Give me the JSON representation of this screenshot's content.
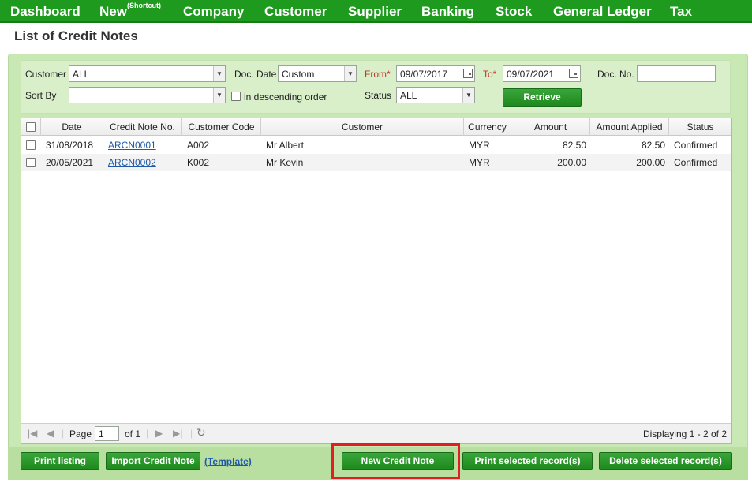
{
  "nav": {
    "items": [
      "Dashboard",
      "New",
      "Company",
      "Customer",
      "Supplier",
      "Banking",
      "Stock",
      "General Ledger",
      "Tax"
    ],
    "new_sup": "(Shortcut)"
  },
  "page": {
    "title": "List of Credit Notes"
  },
  "filters": {
    "customer_label": "Customer",
    "customer_value": "ALL",
    "doc_date_label": "Doc. Date",
    "doc_date_value": "Custom",
    "from_label": "From*",
    "from_value": "09/07/2017",
    "to_label": "To*",
    "to_value": "09/07/2021",
    "doc_no_label": "Doc. No.",
    "doc_no_value": "",
    "sort_by_label": "Sort By",
    "sort_by_value": "",
    "desc_label": "in descending order",
    "status_label": "Status",
    "status_value": "ALL",
    "retrieve_label": "Retrieve"
  },
  "table": {
    "columns": [
      "Date",
      "Credit Note No.",
      "Customer Code",
      "Customer",
      "Currency",
      "Amount",
      "Amount Applied",
      "Status"
    ],
    "rows": [
      {
        "date": "31/08/2018",
        "no": "ARCN0001",
        "code": "A002",
        "customer": "Mr Albert",
        "currency": "MYR",
        "amount": "82.50",
        "applied": "82.50",
        "status": "Confirmed"
      },
      {
        "date": "20/05/2021",
        "no": "ARCN0002",
        "code": "K002",
        "customer": "Mr Kevin",
        "currency": "MYR",
        "amount": "200.00",
        "applied": "200.00",
        "status": "Confirmed"
      }
    ]
  },
  "pager": {
    "page_label": "Page",
    "page_value": "1",
    "of_label": "of 1",
    "displaying": "Displaying 1 - 2 of 2"
  },
  "actions": {
    "print_listing": "Print listing",
    "import_credit_note": "Import Credit Note",
    "template": "(Template)",
    "new_credit_note": "New Credit Note",
    "print_selected": "Print selected record(s)",
    "delete_selected": "Delete selected record(s)"
  },
  "colors": {
    "nav_green": "#1e9a1e",
    "panel_green": "#c8e8b4",
    "button_green": "#2a962a",
    "highlight_red": "#e02020"
  }
}
